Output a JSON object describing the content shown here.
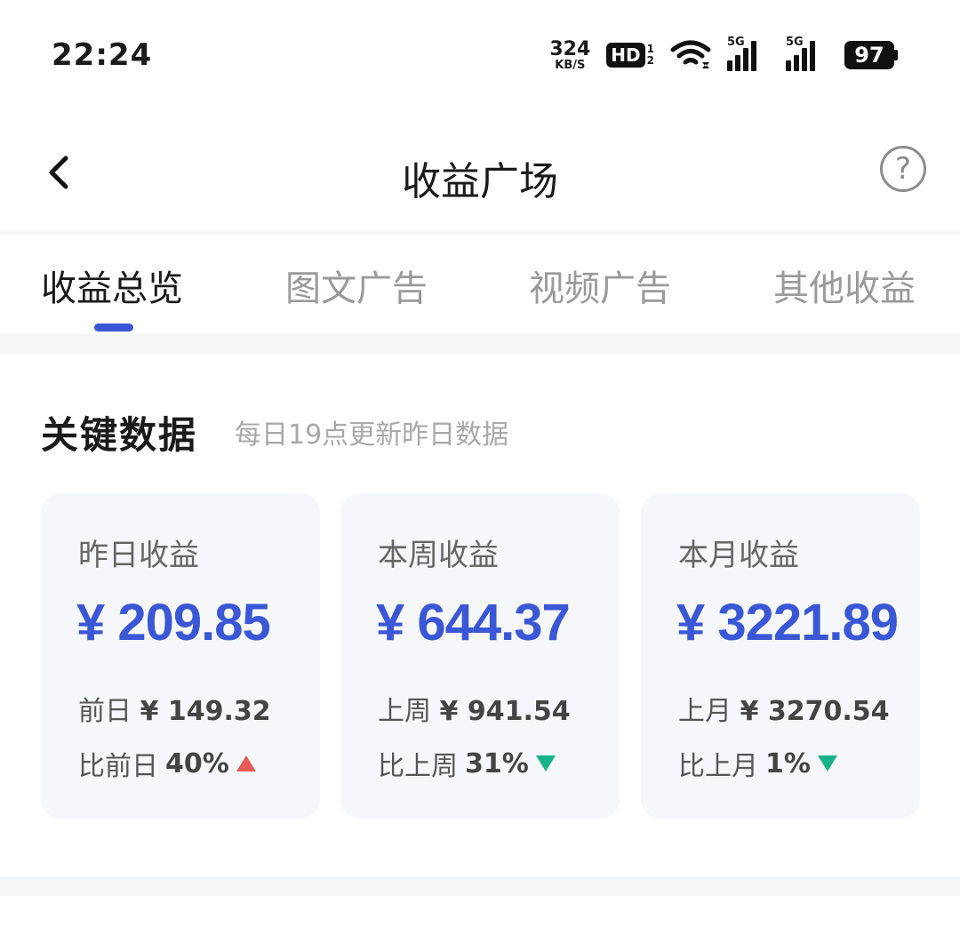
{
  "status_bar": {
    "time": "22:24",
    "net_speed_value": "324",
    "net_speed_unit": "KB/S",
    "hd_label": "HD",
    "hd_sub_1": "1",
    "hd_sub_2": "2",
    "signal_1_label": "5G",
    "signal_2_label": "5G",
    "battery": "97"
  },
  "nav": {
    "title": "收益广场",
    "help_label": "?"
  },
  "tabs": [
    {
      "label": "收益总览",
      "active": true
    },
    {
      "label": "图文广告",
      "active": false
    },
    {
      "label": "视频广告",
      "active": false
    },
    {
      "label": "其他收益",
      "active": false
    }
  ],
  "section": {
    "title": "关键数据",
    "subtitle": "每日19点更新昨日数据"
  },
  "cards": [
    {
      "label": "昨日收益",
      "amount": "¥ 209.85",
      "prev_label": "前日",
      "prev_value": "¥ 149.32",
      "cmp_label": "比前日",
      "cmp_value": "40%",
      "trend": "up"
    },
    {
      "label": "本周收益",
      "amount": "¥ 644.37",
      "prev_label": "上周",
      "prev_value": "¥ 941.54",
      "cmp_label": "比上周",
      "cmp_value": "31%",
      "trend": "down"
    },
    {
      "label": "本月收益",
      "amount": "¥ 3221.89",
      "prev_label": "上月",
      "prev_value": "¥ 3270.54",
      "cmp_label": "比上月",
      "cmp_value": "1%",
      "trend": "down"
    }
  ],
  "colors": {
    "accent": "#3a57d6",
    "up": "#e85a55",
    "down": "#16b38a"
  }
}
